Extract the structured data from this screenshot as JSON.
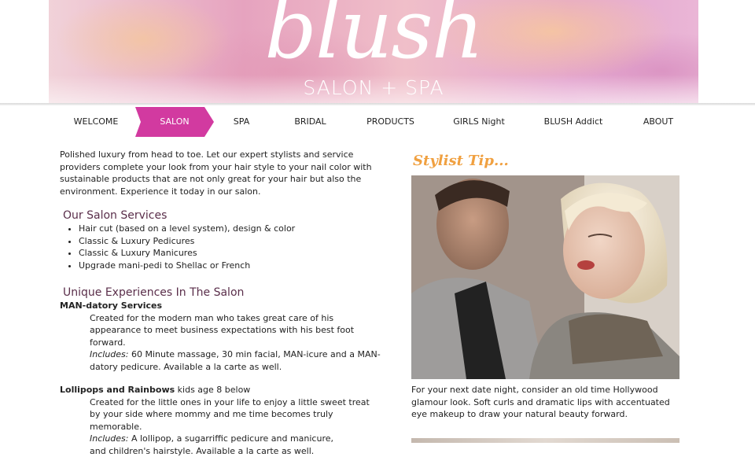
{
  "header": {
    "logo_word": "blush",
    "logo_sub": "SALON + SPA"
  },
  "nav": {
    "items": [
      {
        "label": "WELCOME",
        "active": false
      },
      {
        "label": "SALON",
        "active": true
      },
      {
        "label": "SPA",
        "active": false
      },
      {
        "label": "BRIDAL",
        "active": false
      },
      {
        "label": "PRODUCTS",
        "active": false
      },
      {
        "label": "GIRLS Night",
        "active": false
      },
      {
        "label": "BLUSH Addict",
        "active": false
      },
      {
        "label": "ABOUT",
        "active": false
      }
    ],
    "active_color": "#d23aa0"
  },
  "intro": "Polished luxury from head to toe. Let our expert stylists and service providers complete your look from your hair style to your nail color with sustainable products that are not only great for your hair but also the environment. Experience it today in our salon.",
  "services": {
    "heading": "Our Salon Services",
    "items": [
      "Hair cut (based on a level system), design & color",
      "Classic & Luxury Pedicures",
      "Classic & Luxury Manicures",
      "Upgrade mani-pedi to Shellac or French"
    ]
  },
  "unique": {
    "heading": "Unique Experiences In The Salon",
    "man": {
      "title": "MAN-datory Services",
      "desc": "Created for the modern man who takes great care of his appearance to meet business expectations with his best foot forward.",
      "includes_label": "Includes:",
      "includes_text": "60 Minute massage, 30 min facial, MAN-icure and a MAN-datory pedicure. Available a la carte as well."
    },
    "lollipops": {
      "title": "Lollipops and Rainbows",
      "age": "kids age 8 below",
      "desc": "Created for the little ones in your life to enjoy a little sweet treat by your side where mommy and me time becomes truly memorable.",
      "includes_label": "Includes:",
      "includes_text": "A lollipop, a sugarriffic pedicure and manicure,",
      "includes_text2": "and children's hairstyle. Available a la carte as well."
    }
  },
  "tip": {
    "title": "Stylist Tip...",
    "caption": "For your next date night, consider an old time Hollywood glamour look. Soft curls and dramatic lips with accentuated eye makeup to draw your natural beauty forward."
  },
  "colors": {
    "accent": "#d23aa0",
    "heading": "#5a2e4a",
    "tip": "#f0a040"
  }
}
